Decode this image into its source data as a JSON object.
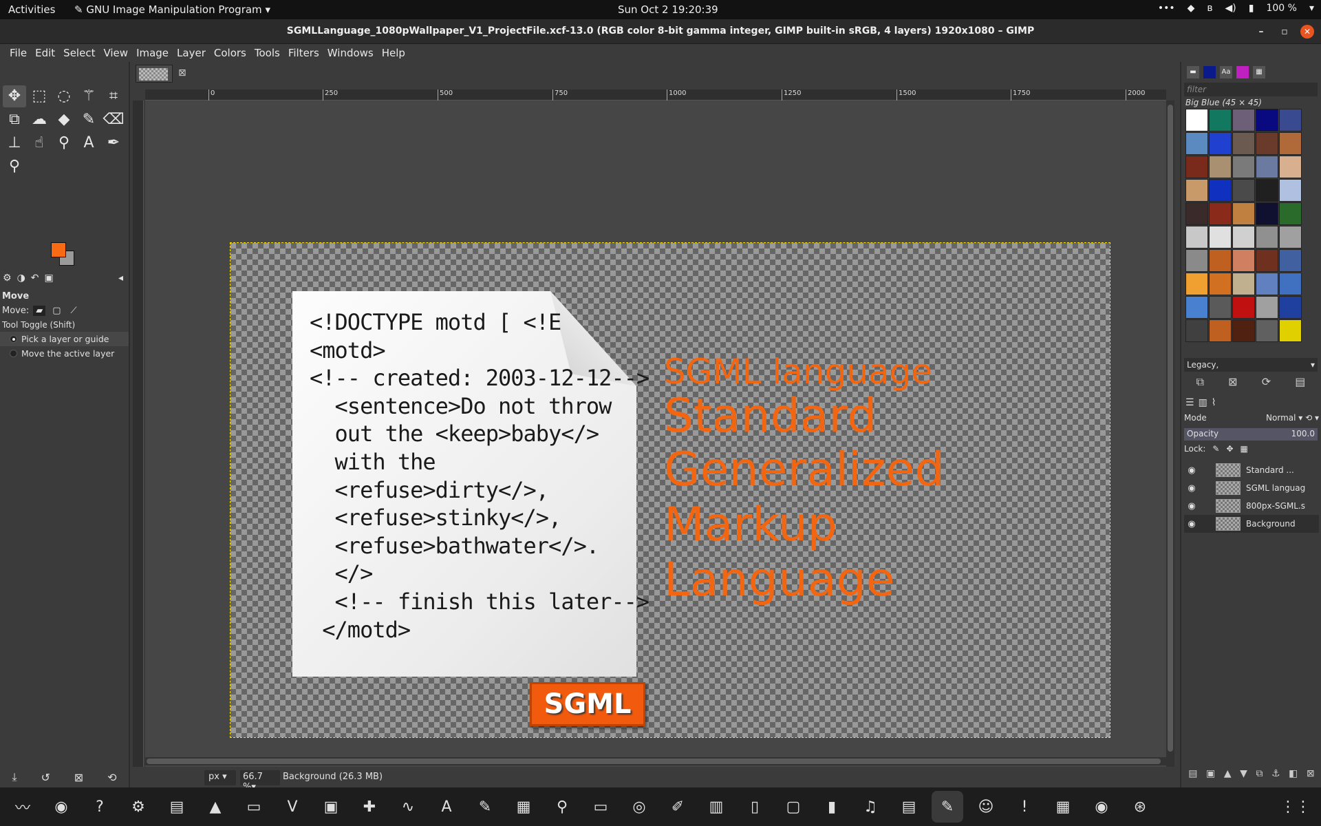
{
  "topbar": {
    "activities": "Activities",
    "app_name": "GNU Image Manipulation Program",
    "clock": "Sun Oct 2  19:20:39",
    "battery": "100 %"
  },
  "window": {
    "title": "SGMLLanguage_1080pWallpaper_V1_ProjectFile.xcf-13.0 (RGB color 8-bit gamma integer, GIMP built-in sRGB, 4 layers) 1920x1080 – GIMP"
  },
  "menubar": {
    "items": [
      "File",
      "Edit",
      "Select",
      "View",
      "Image",
      "Layer",
      "Colors",
      "Tools",
      "Filters",
      "Windows",
      "Help"
    ]
  },
  "toolbox": {
    "colors": {
      "foreground": "#f96a15",
      "background": "#9a9a9a"
    },
    "options": {
      "title": "Move",
      "move_label": "Move:",
      "toggle_label": "Tool Toggle  (Shift)",
      "radio1": "Pick a layer or guide",
      "radio2": "Move the active layer"
    }
  },
  "ruler": {
    "marks": [
      "0",
      "250",
      "500",
      "750",
      "1000",
      "1250",
      "1500",
      "1750",
      "2000"
    ]
  },
  "canvas": {
    "code_lines": [
      "<!DOCTYPE motd [ <!E",
      "<motd>",
      "<!-- created: 2003-12-12-->",
      "  <sentence>Do not throw",
      "  out the <keep>baby</>",
      "  with the",
      "  <refuse>dirty</>,",
      "  <refuse>stinky</>,",
      "  <refuse>bathwater</>.",
      "  </>",
      "  <!-- finish this later-->",
      " </motd>"
    ],
    "badge": "SGML",
    "heading": "SGML language",
    "words": [
      "Standard",
      "Generalized",
      "Markup",
      "Language"
    ]
  },
  "patterns": {
    "filter_placeholder": "filter",
    "selected_name": "Big Blue (45 × 45)",
    "tag": "Legacy,"
  },
  "layers_panel": {
    "mode_label": "Mode",
    "mode_value": "Normal",
    "opacity_label": "Opacity",
    "opacity_value": "100.0",
    "lock_label": "Lock:",
    "layers": [
      "Standard ...",
      "SGML languag",
      "800px-SGML.s",
      "Background"
    ]
  },
  "statusbar": {
    "unit": "px",
    "zoom": "66.7 %",
    "status": "Background (26.3 MB)"
  }
}
